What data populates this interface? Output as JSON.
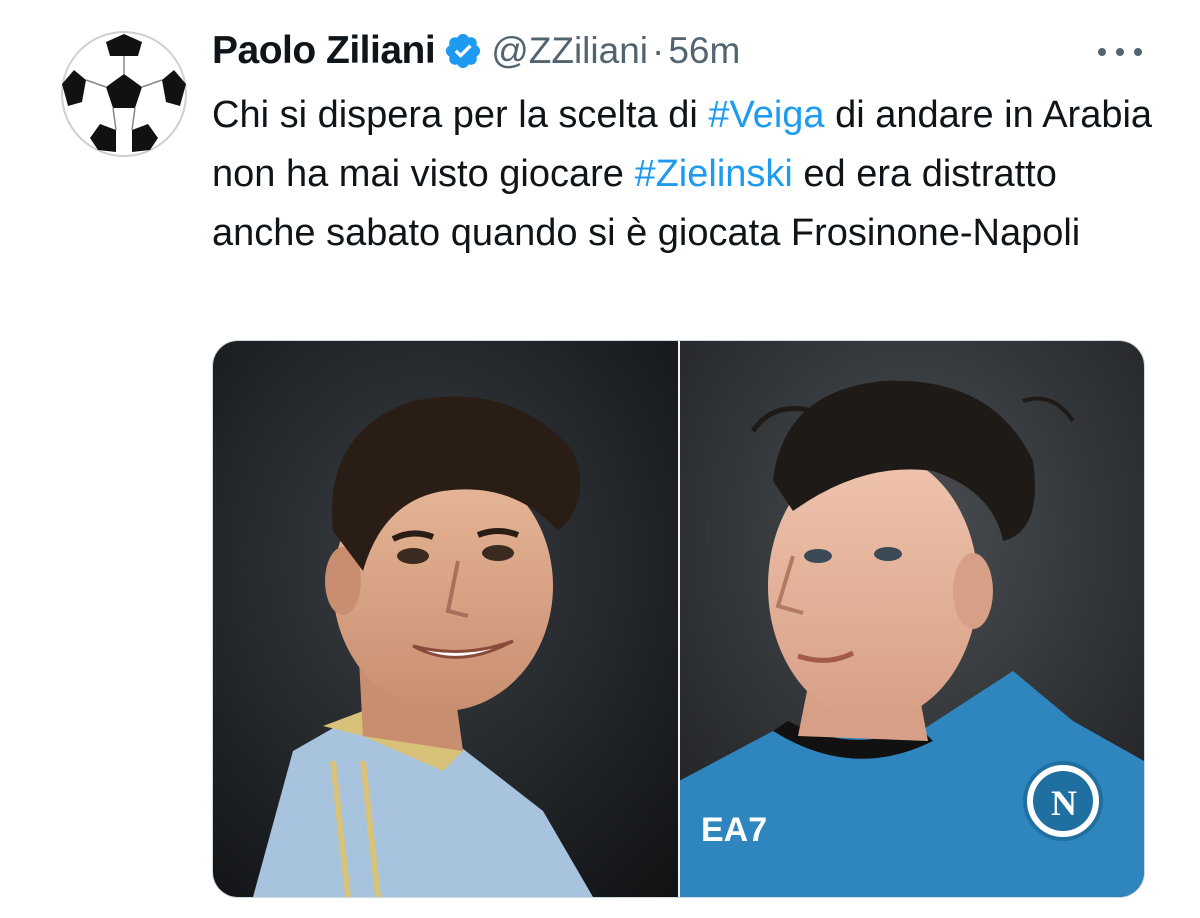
{
  "tweet": {
    "author": {
      "display_name": "Paolo Ziliani",
      "handle": "@ZZiliani",
      "verified": true,
      "avatar_icon": "soccer-ball-icon"
    },
    "separator": "·",
    "timestamp": "56m",
    "text_parts": {
      "p1": "Chi si dispera per la scelta di ",
      "tag1": "#Veiga",
      "p2": " di andare in Arabia non ha mai visto giocare ",
      "tag2": "#Zielinski",
      "p3": " ed era distratto anche sabato quando si è giocata Frosinone-Napoli"
    },
    "media": {
      "left_jersey_text": "",
      "right_jersey_sponsor": "EA7"
    }
  },
  "colors": {
    "link": "#1d9bf0",
    "secondary_text": "#536471",
    "verified": "#1d9bf0"
  }
}
